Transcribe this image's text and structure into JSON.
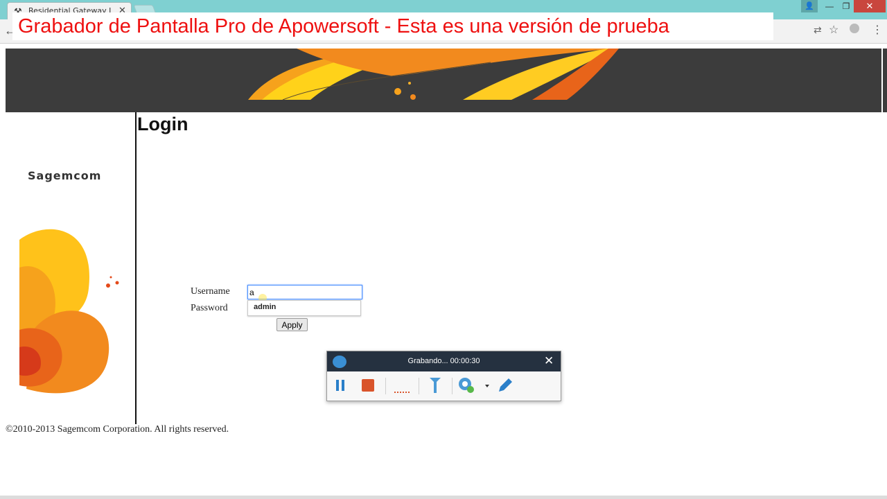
{
  "browser": {
    "tab_title": "Residential Gateway Login",
    "tab_close": "✕",
    "back": "←",
    "translate": "⇄",
    "star": "☆",
    "menu": "⋮",
    "window_user": "👤",
    "window_minimize": "—",
    "window_restore": "❐",
    "window_close": "✕"
  },
  "watermark": {
    "text": "Grabador de Pantalla Pro de Apowersoft - Esta es una versión de prueba"
  },
  "page": {
    "brand": "Sagemcom",
    "title": "Login",
    "form": {
      "username_label": "Username",
      "password_label": "Password",
      "username_value": "a",
      "autocomplete_suggestion": "admin",
      "apply_label": "Apply"
    },
    "footer": "©2010-2013 Sagemcom Corporation. All rights reserved."
  },
  "recorder": {
    "status": "Grabando... 00:00:30",
    "close": "✕",
    "tools": [
      "pause-icon",
      "stop-icon",
      "dotted-line-icon",
      "cursor-icon",
      "webcam-icon",
      "pencil-icon"
    ]
  },
  "colors": {
    "tabstrip": "#7fd0d1",
    "watermark_text": "#ee1010",
    "banner_bg": "#3c3c3c",
    "recorder_header": "#253140",
    "accent_orange": "#f28a1e"
  }
}
